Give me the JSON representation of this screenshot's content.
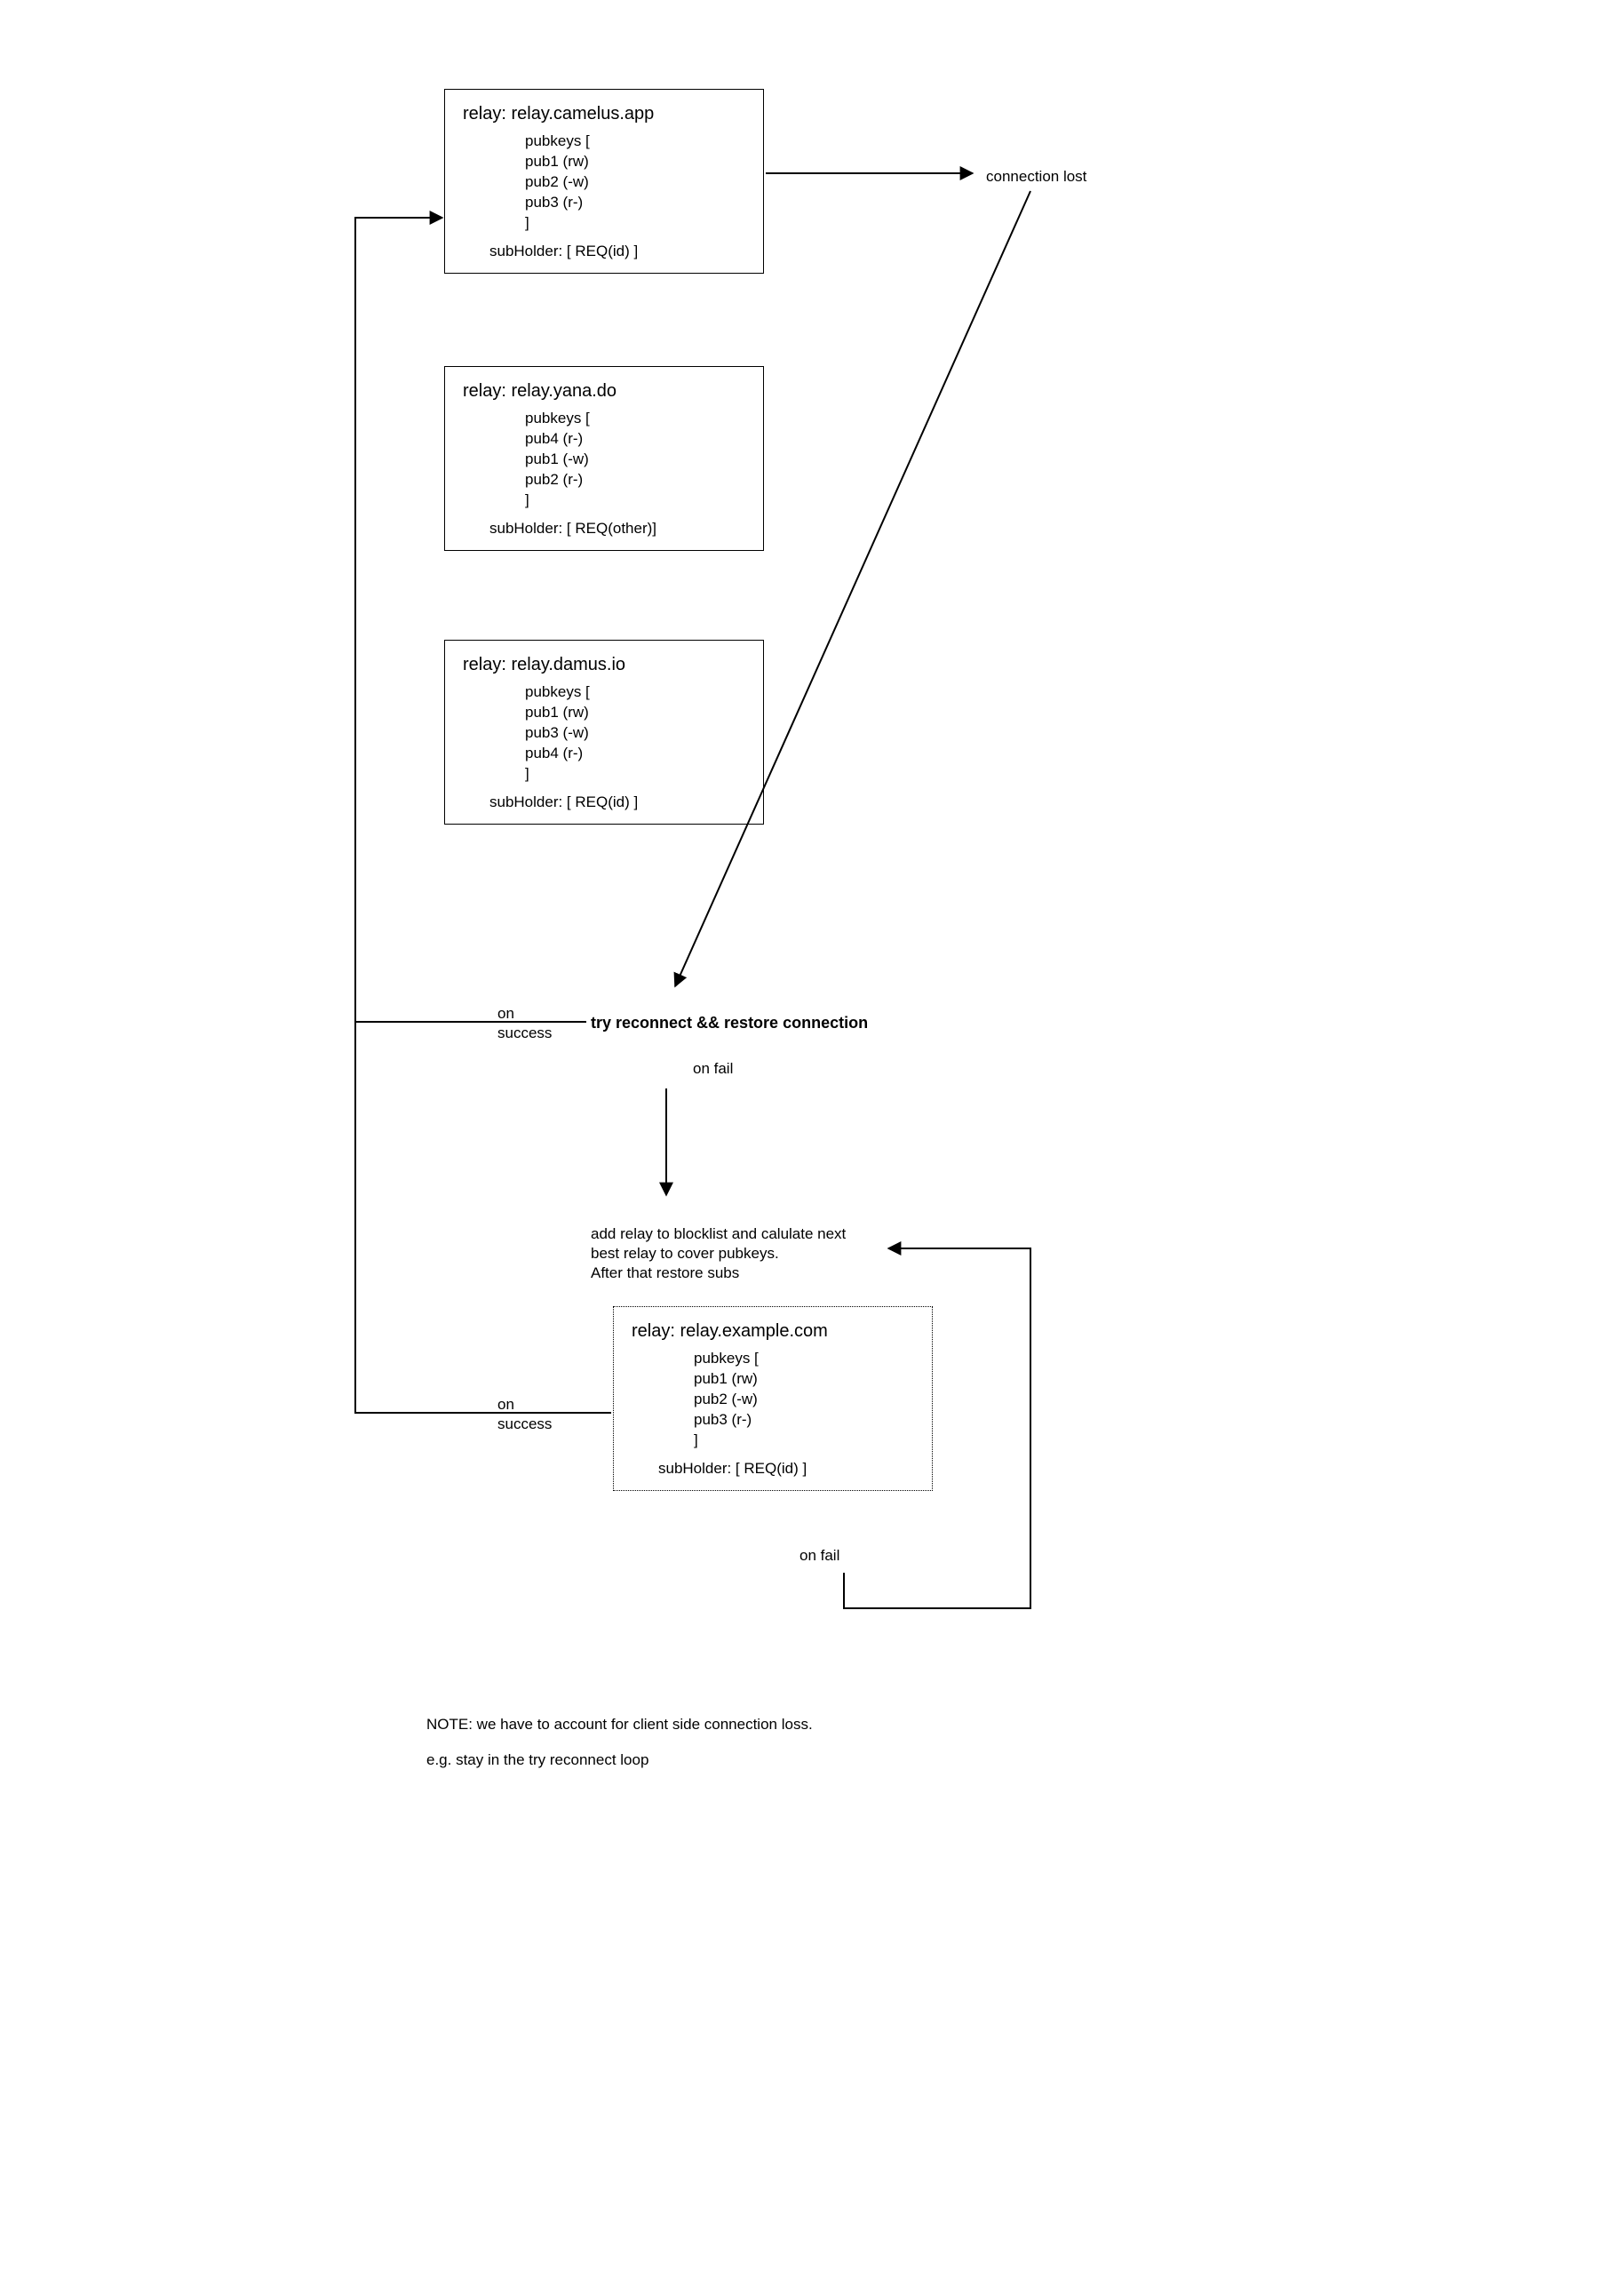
{
  "relays": [
    {
      "title": "relay: relay.camelus.app",
      "pubkeys_open": "pubkeys [",
      "keys": [
        "pub1 (rw)",
        "pub2 (-w)",
        "pub3 (r-)"
      ],
      "close": "]",
      "sub": "subHolder: [ REQ(id) ]"
    },
    {
      "title": "relay: relay.yana.do",
      "pubkeys_open": "pubkeys [",
      "keys": [
        "pub4 (r-)",
        "pub1 (-w)",
        "pub2 (r-)"
      ],
      "close": "]",
      "sub": "subHolder: [ REQ(other)]"
    },
    {
      "title": "relay: relay.damus.io",
      "pubkeys_open": "pubkeys [",
      "keys": [
        "pub1 (rw)",
        "pub3 (-w)",
        "pub4 (r-)"
      ],
      "close": "]",
      "sub": "subHolder: [ REQ(id) ]"
    },
    {
      "title": "relay: relay.example.com",
      "pubkeys_open": "pubkeys [",
      "keys": [
        "pub1 (rw)",
        "pub2 (-w)",
        "pub3 (r-)"
      ],
      "close": "]",
      "sub": "subHolder: [ REQ(id) ]"
    }
  ],
  "labels": {
    "connection_lost": "connection lost",
    "on_success_1": "on\nsuccess",
    "try_reconnect": "try reconnect && restore connection",
    "on_fail_1": "on fail",
    "blocklist": "add relay to blocklist and calulate next\nbest relay to cover pubkeys.\nAfter that restore subs",
    "on_success_2": "on\nsuccess",
    "on_fail_2": "on fail",
    "note_1": "NOTE: we have to account for client side connection loss.",
    "note_2": "e.g. stay in the try reconnect loop"
  }
}
